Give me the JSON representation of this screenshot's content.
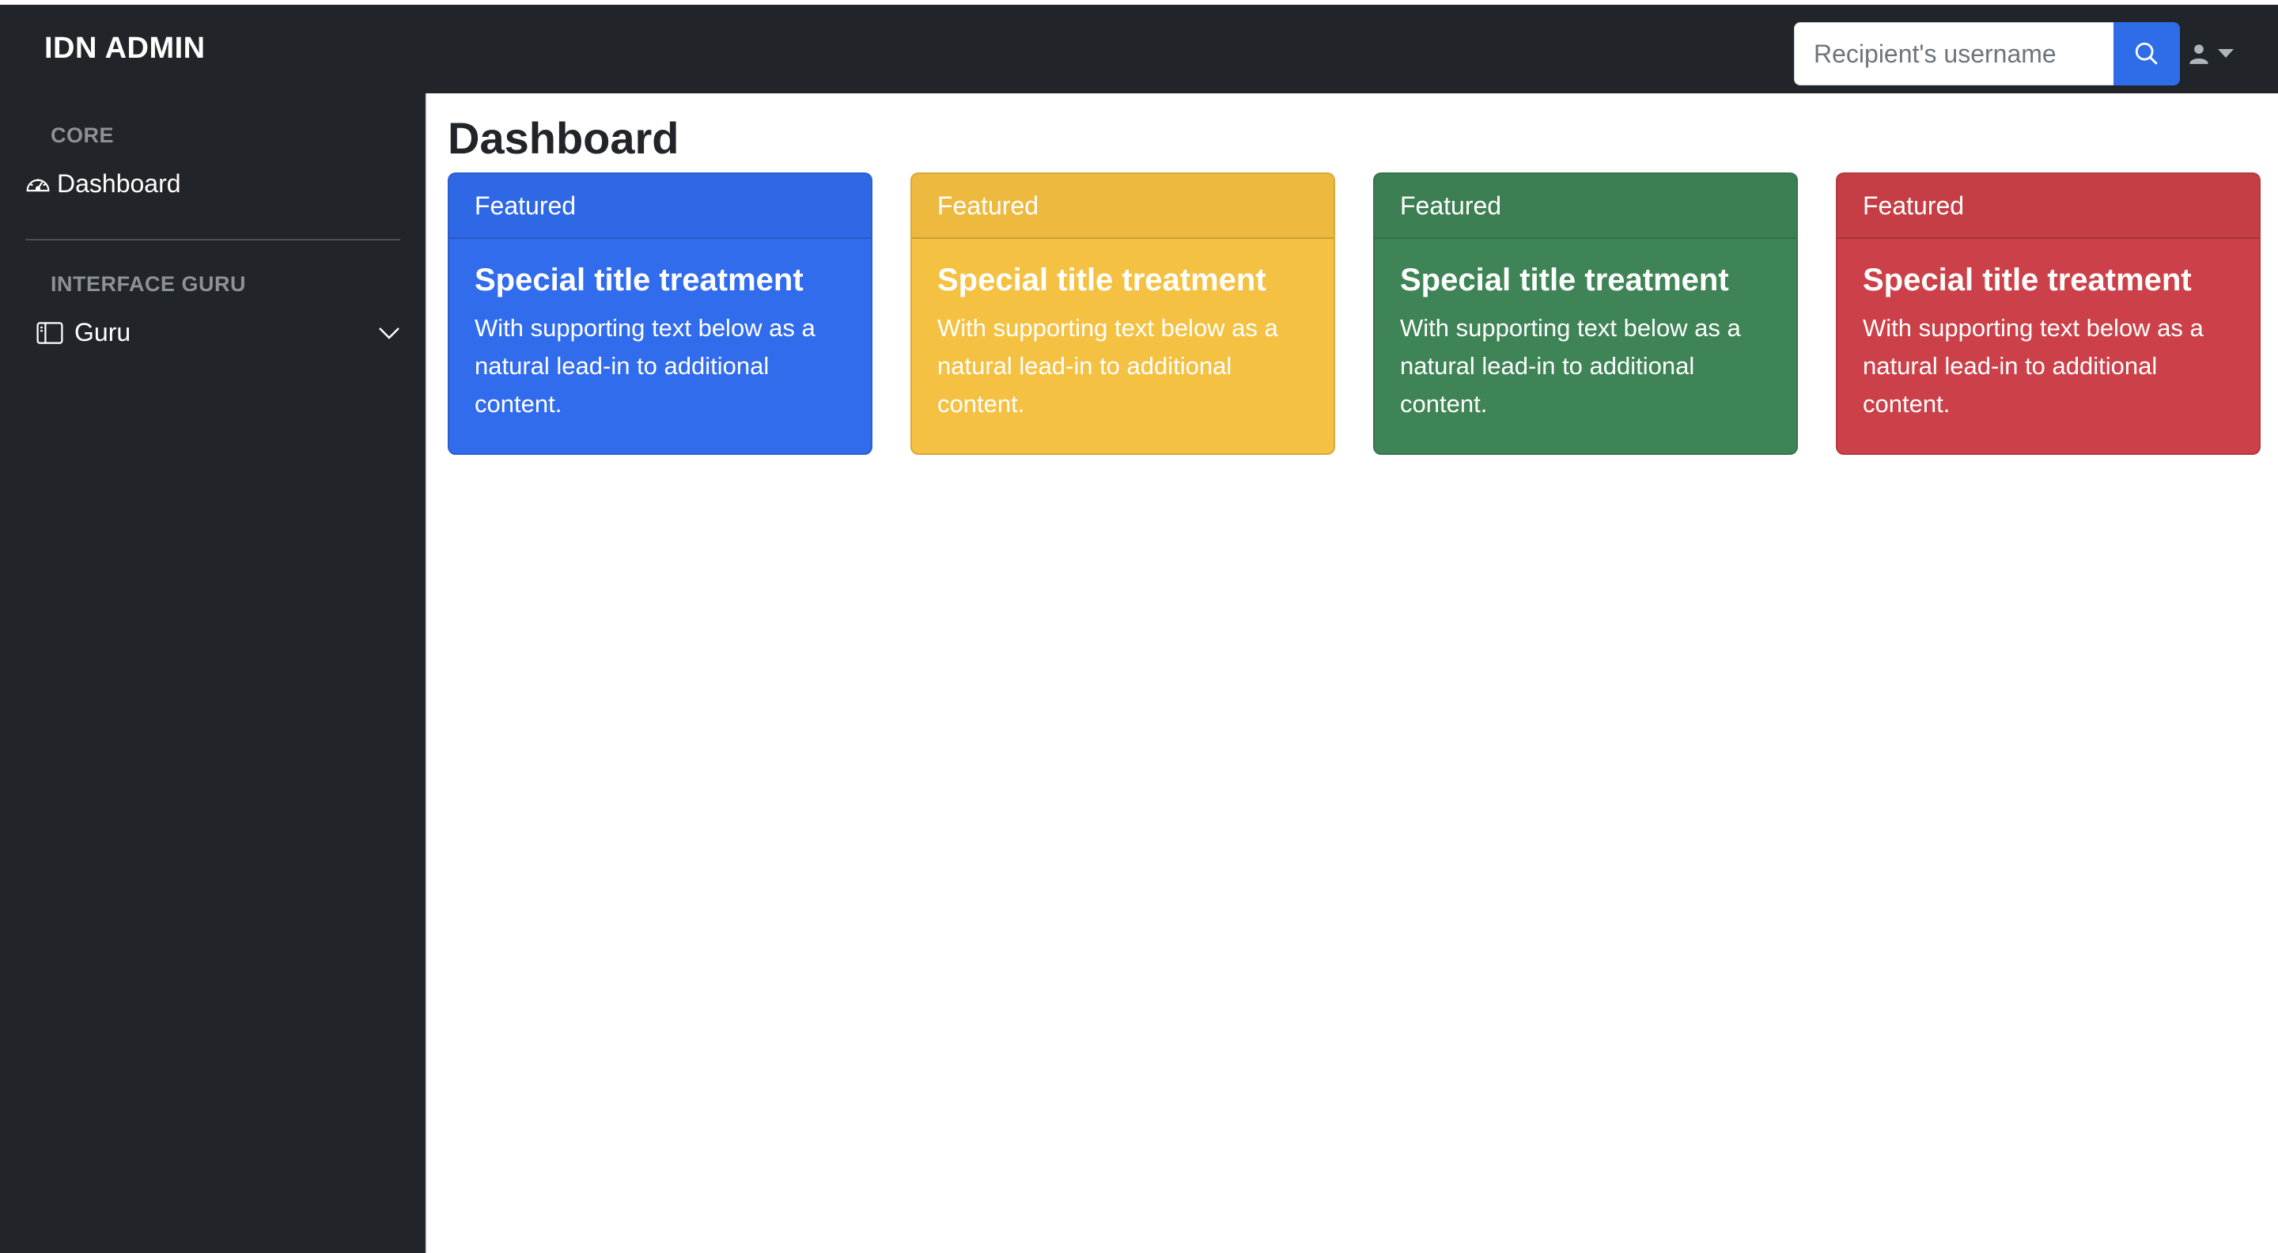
{
  "navbar": {
    "brand": "IDN ADMIN",
    "search_placeholder": "Recipient's username"
  },
  "sidebar": {
    "sections": [
      {
        "heading": "CORE",
        "items": [
          {
            "label": "Dashboard",
            "icon": "speedometer-icon"
          }
        ]
      },
      {
        "heading": "INTERFACE GURU",
        "items": [
          {
            "label": "Guru",
            "icon": "sidebar-panel-icon",
            "expandable": true
          }
        ]
      }
    ]
  },
  "main": {
    "title": "Dashboard",
    "cards": [
      {
        "header": "Featured",
        "title": "Special title treatment",
        "text": "With supporting text below as a natural lead-in to additional content.",
        "color": "#316ced"
      },
      {
        "header": "Featured",
        "title": "Special title treatment",
        "text": "With supporting text below as a natural lead-in to additional content.",
        "color": "#f5c142"
      },
      {
        "header": "Featured",
        "title": "Special title treatment",
        "text": "With supporting text below as a natural lead-in to additional content.",
        "color": "#3e8456"
      },
      {
        "header": "Featured",
        "title": "Special title treatment",
        "text": "With supporting text below as a natural lead-in to additional content.",
        "color": "#cc4149"
      }
    ]
  },
  "colors": {
    "dark": "#212529",
    "primary": "#2f6de8"
  }
}
